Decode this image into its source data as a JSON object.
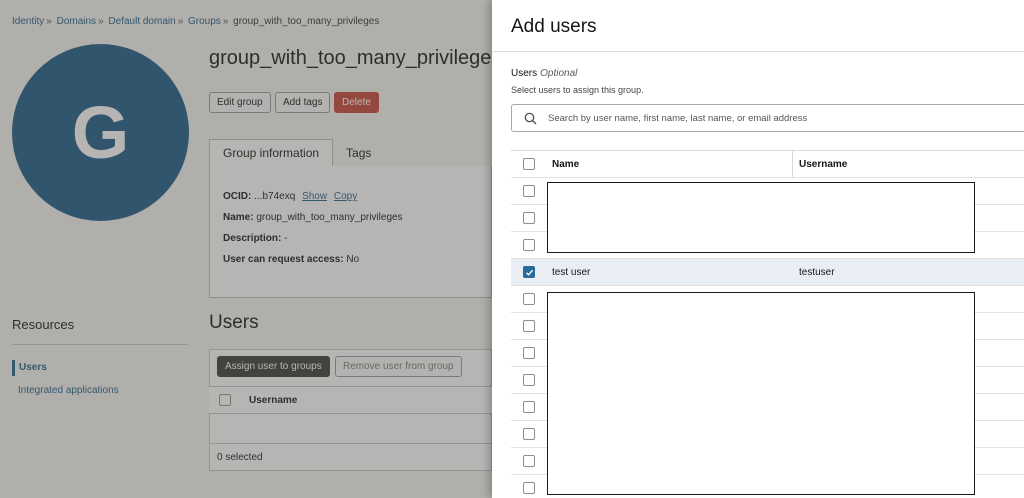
{
  "breadcrumb": {
    "items": [
      "Identity",
      "Domains",
      "Default domain",
      "Groups"
    ],
    "current": "group_with_too_many_privileges",
    "separator": "»"
  },
  "group": {
    "avatar_letter": "G",
    "title": "group_with_too_many_privileges",
    "avatar_color": "#1d5a87"
  },
  "actions": {
    "edit": "Edit group",
    "add_tags": "Add tags",
    "delete": "Delete"
  },
  "tabs": [
    "Group information",
    "Tags"
  ],
  "info": {
    "ocid_label": "OCID:",
    "ocid_value": "...b74exq",
    "show": "Show",
    "copy": "Copy",
    "name_label": "Name:",
    "name_value": "group_with_too_many_privileges",
    "desc_label": "Description:",
    "desc_value": "-",
    "access_label": "User can request access:",
    "access_value": "No"
  },
  "resources": {
    "title": "Resources",
    "items": [
      {
        "label": "Users",
        "active": true
      },
      {
        "label": "Integrated applications",
        "active": false
      }
    ]
  },
  "users_section": {
    "title": "Users",
    "assign": "Assign user to groups",
    "remove": "Remove user from group",
    "col_username": "Username",
    "selected_count": "0 selected"
  },
  "drawer": {
    "title": "Add users",
    "field_label": "Users",
    "field_optional": "Optional",
    "help": "Select users to assign this group.",
    "search_placeholder": "Search by user name, first name, last name, or email address",
    "columns": {
      "name": "Name",
      "username": "Username"
    },
    "selected_row": {
      "name": "test user",
      "username": "testuser"
    }
  },
  "colors": {
    "accent": "#276a9b",
    "danger": "#c74634",
    "link": "#1f5f86"
  }
}
